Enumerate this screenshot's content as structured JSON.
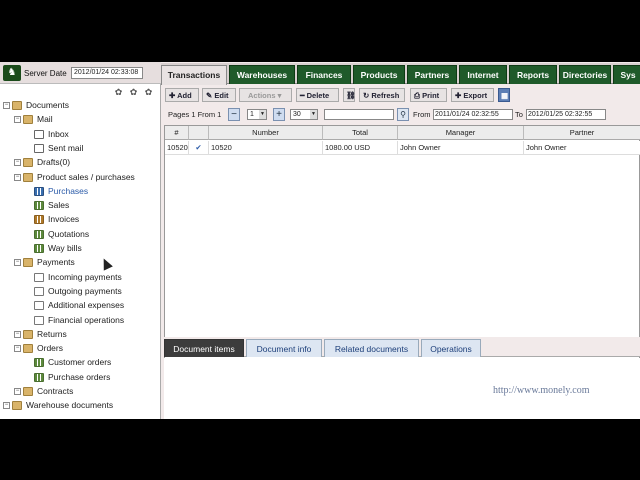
{
  "server": {
    "label": "Server Date",
    "value": "2012/01/24  02:33:08"
  },
  "tree": [
    {
      "label": "Documents",
      "type": "folder",
      "level": 0
    },
    {
      "label": "Mail",
      "type": "folder",
      "level": 1
    },
    {
      "label": "Inbox",
      "type": "mail",
      "level": 2
    },
    {
      "label": "Sent mail",
      "type": "mail",
      "level": 2
    },
    {
      "label": "Drafts(0)",
      "type": "folder",
      "level": 1
    },
    {
      "label": "Product sales / purchases",
      "type": "folder",
      "level": 1
    },
    {
      "label": "Purchases",
      "type": "grid3",
      "level": 2,
      "selected": true
    },
    {
      "label": "Sales",
      "type": "grid",
      "level": 2
    },
    {
      "label": "Invoices",
      "type": "grid2",
      "level": 2
    },
    {
      "label": "Quotations",
      "type": "grid",
      "level": 2
    },
    {
      "label": "Way bills",
      "type": "grid",
      "level": 2
    },
    {
      "label": "Payments",
      "type": "folder",
      "level": 1
    },
    {
      "label": "Incoming payments",
      "type": "doc",
      "level": 2
    },
    {
      "label": "Outgoing payments",
      "type": "doc",
      "level": 2
    },
    {
      "label": "Additional expenses",
      "type": "doc",
      "level": 2
    },
    {
      "label": "Financial operations",
      "type": "doc",
      "level": 2
    },
    {
      "label": "Returns",
      "type": "folder",
      "level": 1
    },
    {
      "label": "Orders",
      "type": "folder",
      "level": 1
    },
    {
      "label": "Customer orders",
      "type": "grid",
      "level": 2
    },
    {
      "label": "Purchase orders",
      "type": "grid",
      "level": 2
    },
    {
      "label": "Contracts",
      "type": "folder",
      "level": 1
    },
    {
      "label": "Warehouse documents",
      "type": "folder",
      "level": 0
    }
  ],
  "tabs": [
    "Transactions",
    "Warehouses",
    "Finances",
    "Products",
    "Partners",
    "Internet",
    "Reports",
    "Directories",
    "Sys"
  ],
  "toolbar": {
    "add": "Add",
    "edit": "Edit",
    "actions": "Actions",
    "delete": "Delete",
    "refresh": "Refresh",
    "print": "Print",
    "export": "Export"
  },
  "pager": {
    "text": "Pages 1 From 1",
    "page": "1",
    "per_page": "30",
    "from_label": "From",
    "from_date": "2011/01/24  02:32:55",
    "to_label": "To",
    "to_date": "2012/01/25  02:32:55"
  },
  "grid": {
    "headers": [
      "#",
      "",
      "Number",
      "Total",
      "Manager",
      "Partner"
    ],
    "rows": [
      {
        "id": "10520",
        "check": "✔",
        "number": "10520",
        "total": "1080.00 USD",
        "manager": "John  Owner",
        "partner": "John  Owner"
      }
    ]
  },
  "bottom_tabs": [
    "Document items",
    "Document info",
    "Related documents",
    "Operations"
  ],
  "watermark": "http://www.monely.com",
  "colors": {
    "tab_green": "#1f5a2a",
    "link_blue": "#2a5aa8"
  }
}
